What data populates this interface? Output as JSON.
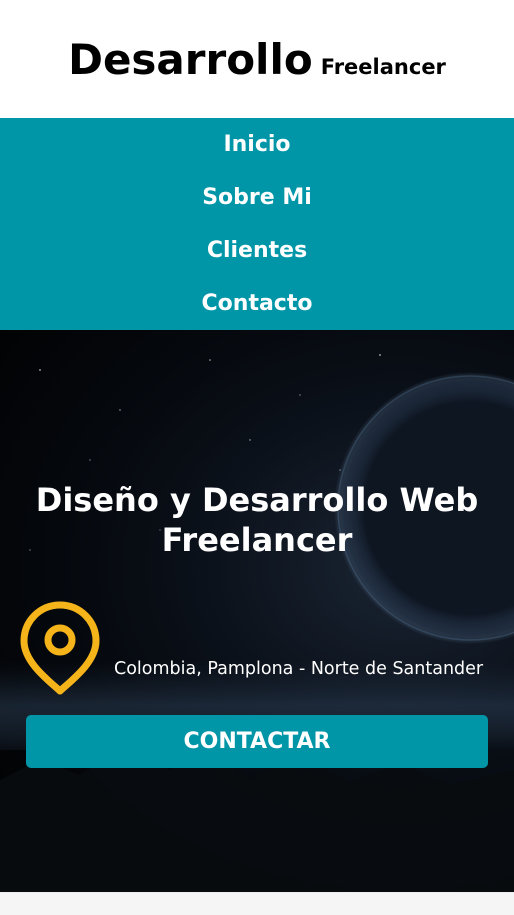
{
  "header": {
    "logo_main": "Desarrollo",
    "logo_sub": "Freelancer"
  },
  "nav": {
    "items": [
      {
        "label": "Inicio"
      },
      {
        "label": "Sobre Mi"
      },
      {
        "label": "Clientes"
      },
      {
        "label": "Contacto"
      }
    ]
  },
  "hero": {
    "title": "Diseño y Desarrollo Web Freelancer",
    "location": "Colombia, Pamplona - Norte de Santander",
    "location_icon": "map-pin-icon",
    "cta_label": "CONTACTAR"
  },
  "colors": {
    "accent": "#0096a8",
    "pin": "#f4b41a",
    "hero_background": "#000000"
  }
}
